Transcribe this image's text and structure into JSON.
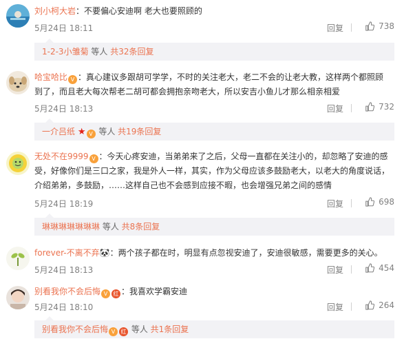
{
  "comments": [
    {
      "username": "刘小柯大岩",
      "text": "：不要偏心安迪啊  老大也要照顾的",
      "time": "5月24日 18:11",
      "reply_label": "回复",
      "likes": "738",
      "thread": {
        "name": "1-2-3小雏菊",
        "suffix": " 等人 ",
        "count": "共32条回复"
      }
    },
    {
      "username": "哈宝哈比",
      "text_line1": "：真心建议多跟胡可学学，不时的关注老大，老二不会的让老大教，这样两个都照顾",
      "text_line2": "到了，而且老大每次帮老二胡可都会拥抱亲吻老大，所以安吉小鱼儿才那么相亲相爱",
      "time": "5月24日 18:13",
      "reply_label": "回复",
      "likes": "732",
      "thread": {
        "name": "一介吕纸",
        "suffix": " 等人 ",
        "count": "共19条回复"
      }
    },
    {
      "username": "无处不在9999",
      "text_line1": "：今天心疼安迪，当弟弟来了之后，父母一直都在关注小的，却忽略了安迪的感",
      "text_line2": "受，好像你们是三口之家，我是外人一样，其实，作为父母应该多鼓励老大，以老大的角度说话，",
      "text_line3": "介绍弟弟，多鼓励，……这样自己也不会感到应接不暇，也会增强兄弟之间的感情",
      "time": "5月24日 18:19",
      "reply_label": "回复",
      "likes": "698",
      "thread": {
        "name": "琳琳琳琳琳琳琳",
        "suffix": " 等人 ",
        "count": "共8条回复"
      }
    },
    {
      "username": "forever-不离不弃",
      "text": "：两个孩子都在时，明显有点忽视安迪了，安迪很敏感，需要更多的关心。",
      "time": "5月24日 18:13",
      "reply_label": "回复",
      "likes": "454"
    },
    {
      "username": "别看我你不会后悔",
      "text": "：我喜欢学霸安迪",
      "time": "5月24日 18:10",
      "reply_label": "回复",
      "likes": "264",
      "thread": {
        "name": "别看我你不会后悔",
        "suffix": " 等人 ",
        "count": "共1条回复"
      }
    }
  ],
  "badges": {
    "vip": "V",
    "red": "红"
  },
  "colors": {
    "username": "#eb7350",
    "reply_bg": "#f2f2f5",
    "meta": "#808080"
  }
}
